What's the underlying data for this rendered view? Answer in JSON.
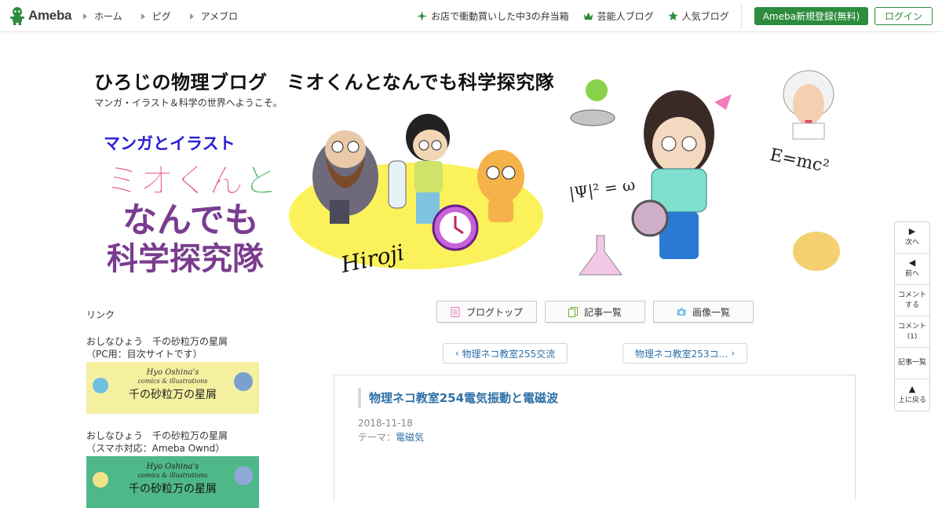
{
  "header": {
    "logo_text": "Ameba",
    "nav": [
      "ホーム",
      "ピグ",
      "アメブロ"
    ],
    "promo_links": [
      {
        "label": "お店で衝動買いした中3の弁当箱",
        "icon": "sparkle-icon"
      },
      {
        "label": "芸能人ブログ",
        "icon": "crown-icon"
      },
      {
        "label": "人気ブログ",
        "icon": "star-icon"
      }
    ],
    "register_label": "Ameba新規登録(無料)",
    "login_label": "ログイン",
    "accent_color": "#2d8c3c"
  },
  "blog": {
    "title": "ひろじの物理ブログ　ミオくんとなんでも科学探究隊",
    "description": "マンガ・イラスト＆科学の世界へようこそ。",
    "banner": {
      "logo_line1": "マンガとイラスト",
      "logo_line2": "ミオくんと",
      "logo_line3": "なんでも",
      "logo_line4": "科学探究隊",
      "signature": "Hiroji",
      "formula_psi": "|Ψ|² = ω",
      "formula_emc": "E=mc²"
    }
  },
  "sidebar": {
    "heading": "リンク",
    "links": [
      {
        "title": "おしなひょう　千の砂粒万の星屑",
        "sub": "（PC用：目次サイトです）",
        "thumb_line1": "Hyo Oshina's",
        "thumb_line2": "comics & illustrations",
        "thumb_line3": "千の砂粒万の星屑",
        "thumb_bg": "#f4f0a0"
      },
      {
        "title": "おしなひょう　千の砂粒万の星屑",
        "sub": "（スマホ対応：Ameba Ownd）",
        "thumb_line1": "Hyo Oshina's",
        "thumb_line2": "comics & illustrations",
        "thumb_line3": "千の砂粒万の星屑",
        "thumb_bg": "#4fb889"
      }
    ]
  },
  "main": {
    "buttons": [
      {
        "label": "ブログトップ",
        "icon": "document-icon"
      },
      {
        "label": "記事一覧",
        "icon": "copy-icon"
      },
      {
        "label": "画像一覧",
        "icon": "camera-icon"
      }
    ],
    "prev_label": "物理ネコ教室255交流",
    "next_label": "物理ネコ教室253コ…",
    "article": {
      "title": "物理ネコ教室254電気振動と電磁波",
      "date": "2018-11-18",
      "theme_label": "テーマ：",
      "theme": "電磁気"
    }
  },
  "floatbar": {
    "items": [
      {
        "icon": "▶",
        "label": "次へ"
      },
      {
        "icon": "◀",
        "label": "前へ"
      },
      {
        "icon": "",
        "label": "コメント\nする"
      },
      {
        "icon": "",
        "label": "コメント\n(1)"
      },
      {
        "icon": "",
        "label": "記事一覧"
      },
      {
        "icon": "▲",
        "label": "上に戻る"
      }
    ]
  }
}
